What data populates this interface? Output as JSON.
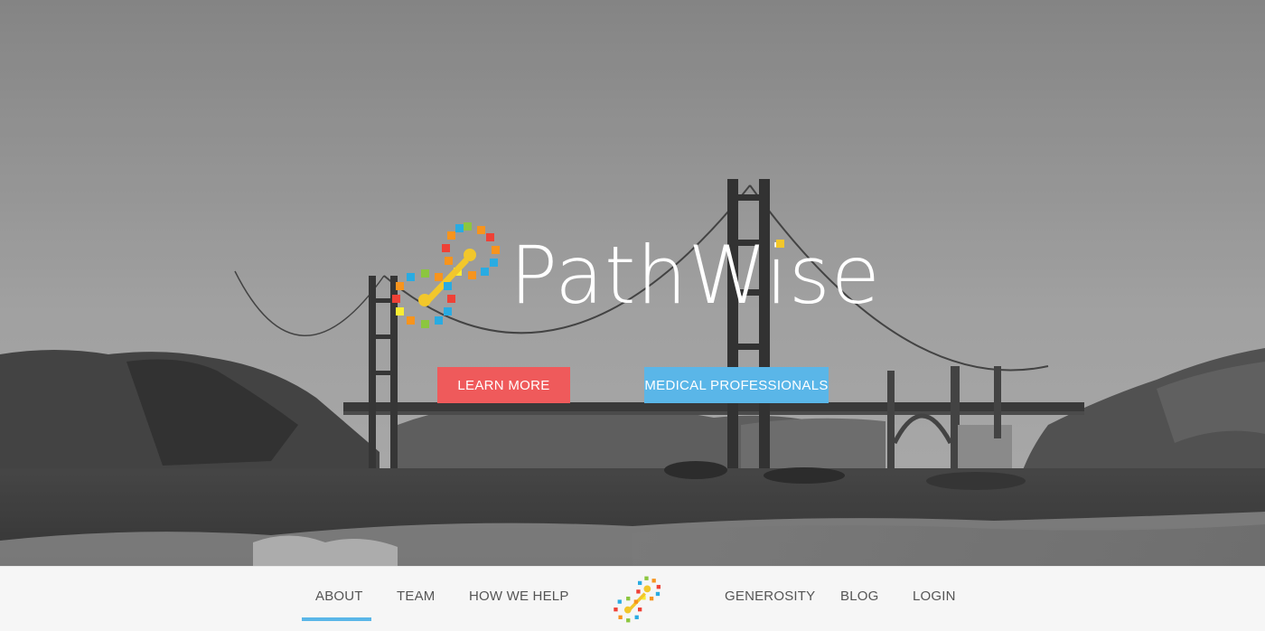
{
  "hero": {
    "brand_name": "PathWise",
    "buttons": {
      "learn_more": "LEARN MORE",
      "medical_professionals": "MEDICAL PROFESSIONALS"
    }
  },
  "nav": {
    "items": [
      {
        "label": "ABOUT",
        "active": true
      },
      {
        "label": "TEAM"
      },
      {
        "label": "HOW WE HELP"
      },
      {
        "label": "GENEROSITY"
      },
      {
        "label": "BLOG"
      },
      {
        "label": "LOGIN"
      }
    ]
  },
  "colors": {
    "learn_more": "#ef5a5b",
    "medical_professionals": "#5ab6e8",
    "active_underline": "#5ab6e8",
    "nav_background": "#f6f6f6",
    "nav_text": "#555555"
  },
  "icons": {
    "brand_logo": "pathwise-gears-logo-icon",
    "nav_logo": "pathwise-gears-logo-icon"
  }
}
